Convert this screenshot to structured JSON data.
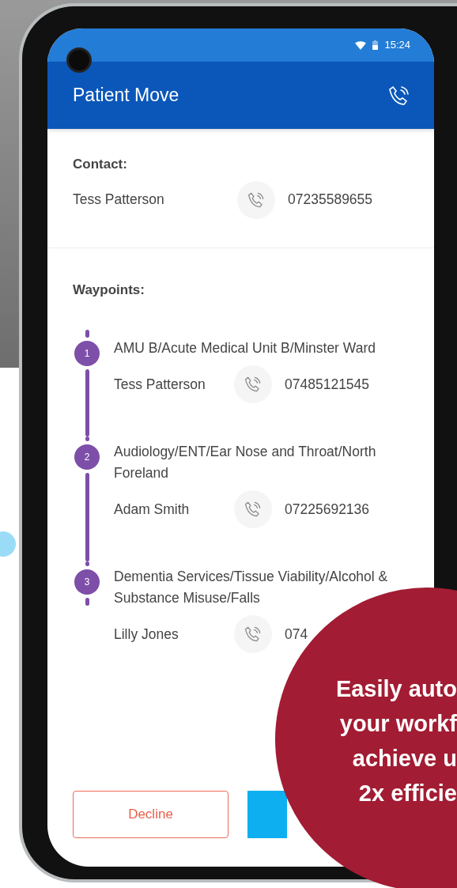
{
  "status_bar": {
    "time": "15:24"
  },
  "app_bar": {
    "title": "Patient Move"
  },
  "contact": {
    "heading": "Contact:",
    "name": "Tess Patterson",
    "phone": "07235589655"
  },
  "waypoints_heading": "Waypoints:",
  "waypoints": [
    {
      "number": "1",
      "location": "AMU B/Acute Medical Unit B/Minster Ward",
      "name": "Tess Patterson",
      "phone": "07485121545"
    },
    {
      "number": "2",
      "location": "Audiology/ENT/Ear Nose and Throat/North Foreland",
      "name": "Adam Smith",
      "phone": "07225692136"
    },
    {
      "number": "3",
      "location": "Dementia Services/Tissue Viability/Alcohol & Substance Misuse/Falls",
      "name": "Lilly Jones",
      "phone": "074"
    }
  ],
  "buttons": [
    {
      "kind": "outline",
      "label": "Decline"
    },
    {
      "kind": "primary"
    }
  ],
  "promo": {
    "lines": [
      "Easily auto",
      "your workf",
      "achieve u",
      "2x efficie"
    ]
  }
}
